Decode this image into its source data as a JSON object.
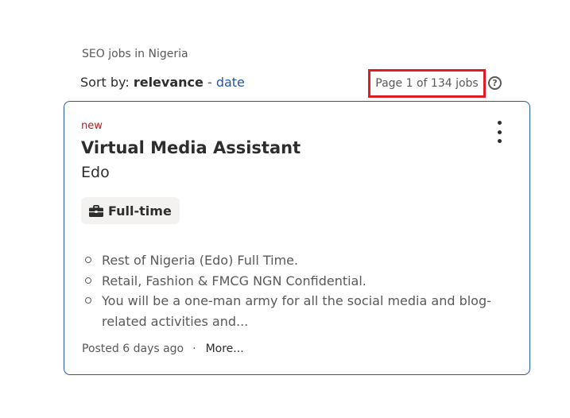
{
  "search": {
    "title": "SEO jobs in Nigeria",
    "sort_prefix": "Sort by: ",
    "sort_current": "relevance",
    "sort_separator": " - ",
    "sort_alternative": "date",
    "page_count": "Page 1 of 134 jobs",
    "help_symbol": "?"
  },
  "job": {
    "badge": "new",
    "title": "Virtual Media Assistant",
    "location": "Edo",
    "type": "Full-time",
    "type_icon": "briefcase-icon",
    "snippet": [
      "Rest of Nigeria (Edo) Full Time.",
      "Retail, Fashion & FMCG NGN Confidential.",
      "You will be a one-man army for all the social media and blog-related activities and..."
    ],
    "posted": "Posted 6 days ago",
    "separator": "·",
    "more": "More..."
  },
  "colors": {
    "link": "#2557a7",
    "new_badge": "#a9252b",
    "highlight_box": "#e01b24"
  }
}
